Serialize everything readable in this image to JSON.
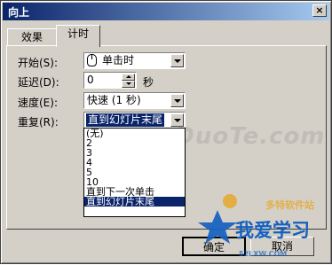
{
  "dialog": {
    "title": "向上",
    "close_label": "×"
  },
  "tabs": [
    {
      "label": "效果"
    },
    {
      "label": "计时"
    }
  ],
  "fields": {
    "start_label": "开始(S):",
    "start_value": "单击时",
    "delay_label": "延迟(D):",
    "delay_value": "0",
    "delay_unit": "秒",
    "speed_label": "速度(E):",
    "speed_value": "快速 (1 秒)",
    "repeat_label": "重复(R):",
    "repeat_value": "直到幻灯片末尾"
  },
  "repeat_options": [
    "(无)",
    "2",
    "3",
    "4",
    "5",
    "10",
    "直到下一次单击",
    "直到幻灯片末尾"
  ],
  "buttons": {
    "ok": "确定",
    "cancel": "取消"
  },
  "watermark": {
    "site": "www.DuoTe.com",
    "logo_text_1": "我爱学习",
    "logo_text_2": "多特软件站",
    "logo_url": "52LXW.COM"
  },
  "colors": {
    "face": "#d4d0c8",
    "title_start": "#0a246a",
    "title_end": "#a6caf0",
    "selection": "#0a246a",
    "logo_blue": "#1560c0",
    "logo_gold": "#e8a317"
  }
}
